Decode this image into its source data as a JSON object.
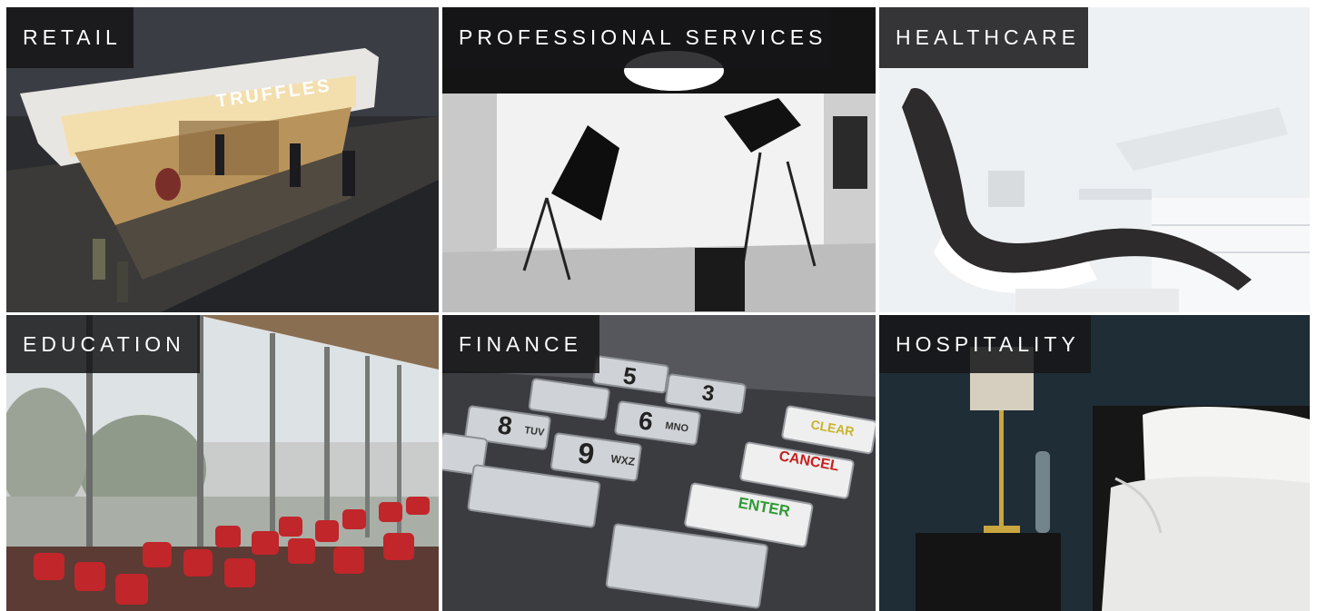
{
  "tiles": [
    {
      "label": "RETAIL",
      "sign": "TRUFFLES"
    },
    {
      "label": "PROFESSIONAL SERVICES"
    },
    {
      "label": "HEALTHCARE"
    },
    {
      "label": "EDUCATION"
    },
    {
      "label": "FINANCE",
      "keys": {
        "five": "5",
        "three": "3",
        "eight": "8",
        "six": "6",
        "nine": "9",
        "mno": "MNO",
        "wxz": "WXZ",
        "tuv": "TUV",
        "cancel": "CANCEL",
        "enter": "ENTER",
        "clear": "CLEAR"
      }
    },
    {
      "label": "HOSPITALITY"
    }
  ]
}
